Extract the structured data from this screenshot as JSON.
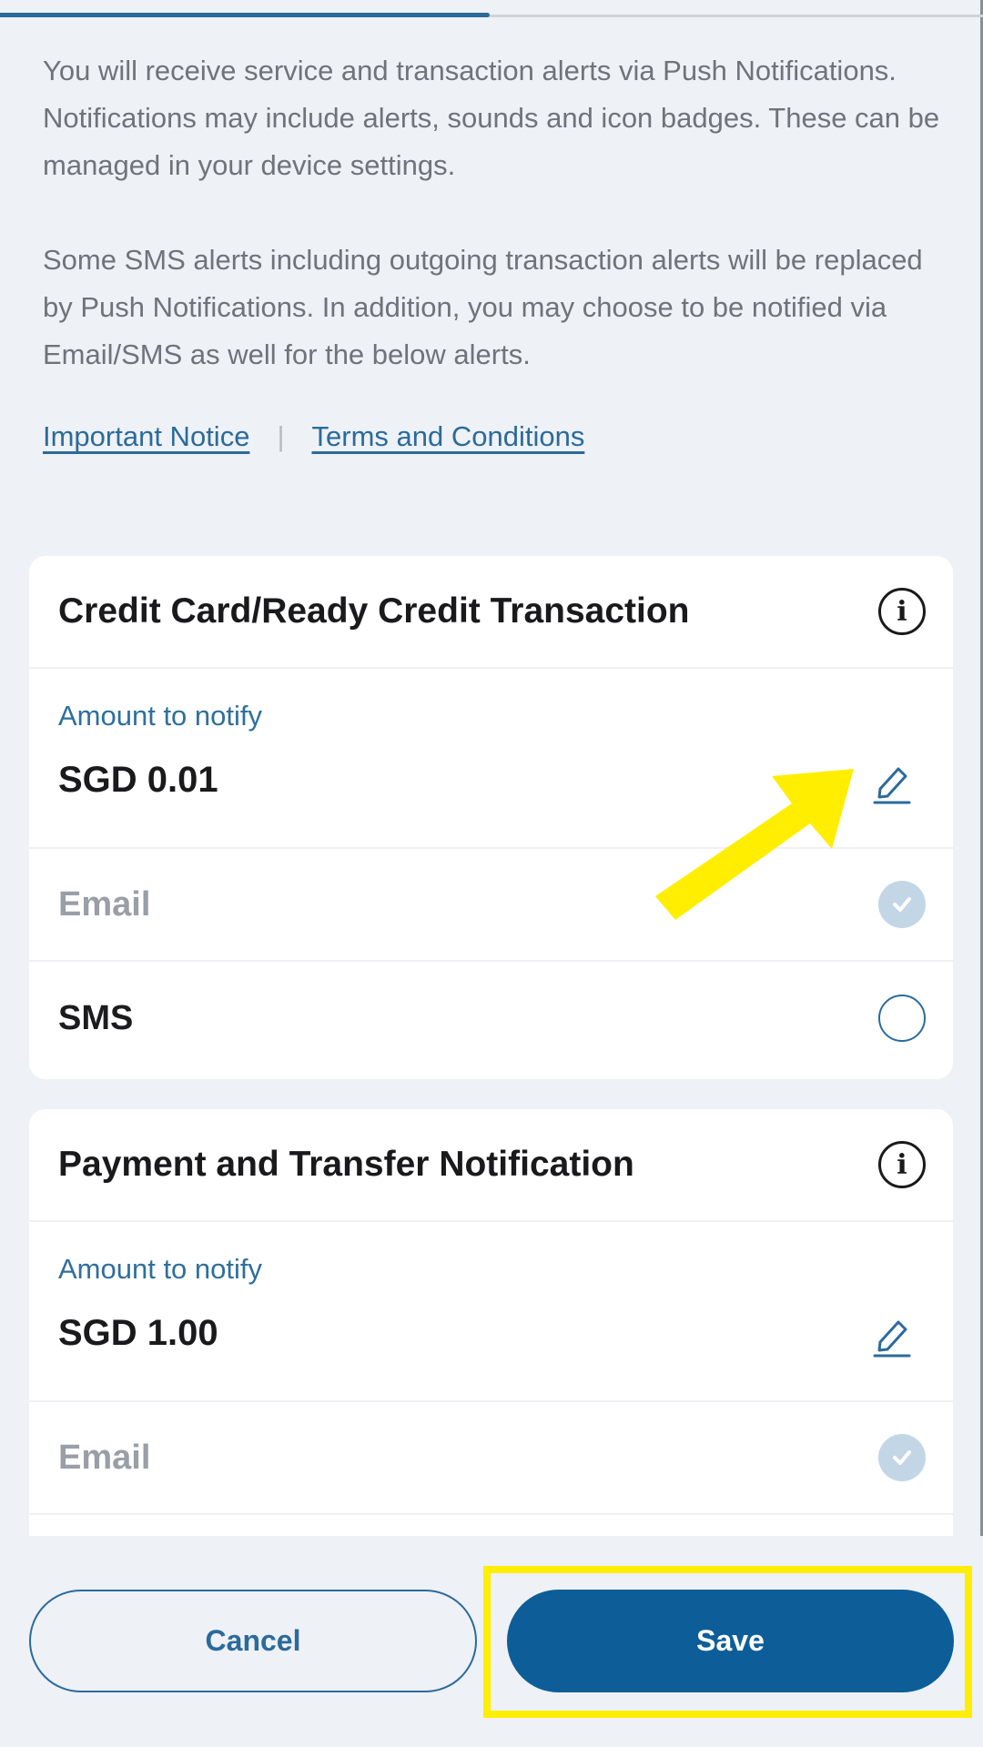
{
  "intro": {
    "paragraph_1": "You will receive service and transaction alerts via Push Notifications. Notifications may include alerts, sounds and icon badges. These can be managed in your device settings.",
    "paragraph_2": "Some SMS alerts including outgoing transaction alerts will be replaced by Push Notifications. In addition, you may choose to be notified via Email/SMS as well for the below alerts."
  },
  "links": {
    "important_notice": "Important Notice",
    "separator": "|",
    "terms": "Terms and Conditions"
  },
  "cards": [
    {
      "title": "Credit Card/Ready Credit Transaction",
      "amount_label": "Amount to notify",
      "amount_value": "SGD 0.01",
      "options": [
        {
          "label": "Email",
          "checked": true,
          "disabled": true
        },
        {
          "label": "SMS",
          "checked": false,
          "disabled": false
        }
      ]
    },
    {
      "title": "Payment and Transfer Notification",
      "amount_label": "Amount to notify",
      "amount_value": "SGD 1.00",
      "options": [
        {
          "label": "Email",
          "checked": true,
          "disabled": true
        }
      ]
    }
  ],
  "buttons": {
    "cancel": "Cancel",
    "save": "Save"
  },
  "colors": {
    "accent": "#0d5e98",
    "link": "#2b6b99",
    "highlight": "#ffee00"
  },
  "icons": {
    "info": "info-icon",
    "edit": "pencil-icon",
    "checked": "check-circle-icon",
    "unchecked": "empty-circle-icon"
  }
}
